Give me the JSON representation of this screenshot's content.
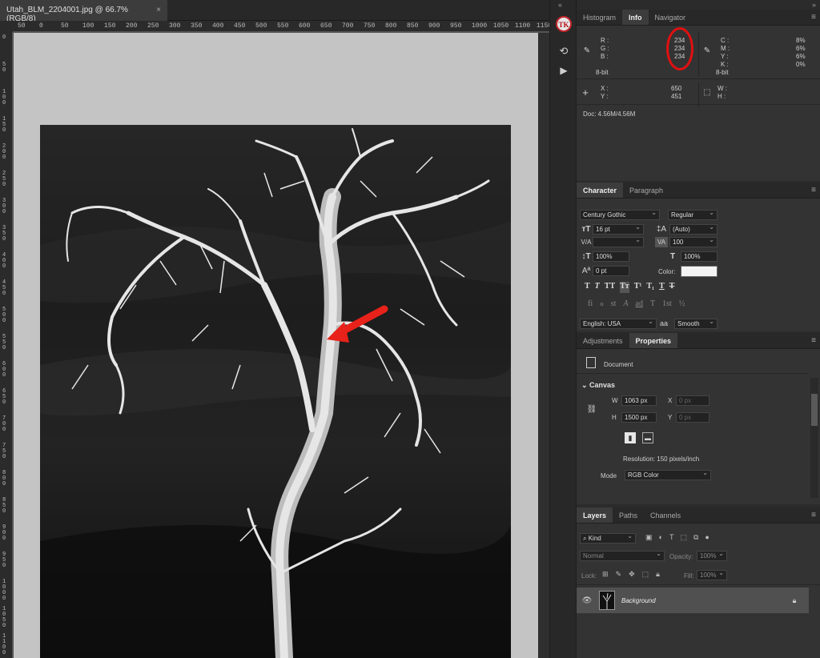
{
  "document": {
    "tab_title": "Utah_BLM_2204001.jpg @ 66.7% (RGB/8)",
    "close_label": "×"
  },
  "ruler": {
    "top_ticks": [
      "50",
      "0",
      "50",
      "100",
      "150",
      "200",
      "250",
      "300",
      "350",
      "400",
      "450",
      "500",
      "550",
      "600",
      "650",
      "700",
      "750",
      "800",
      "850",
      "900",
      "950",
      "1000",
      "1050",
      "1100",
      "1150"
    ],
    "left_ticks": [
      "0",
      "50",
      "100",
      "150",
      "200",
      "250",
      "300",
      "350",
      "400",
      "450",
      "500",
      "550",
      "600",
      "650",
      "700",
      "750",
      "800",
      "850",
      "900",
      "950",
      "1000",
      "1050",
      "1100"
    ]
  },
  "toolstrip": {
    "icons": [
      "tk-logo-icon",
      "history-icon",
      "actions-play-icon"
    ],
    "collapse": "«"
  },
  "panels_collapse": "»",
  "info_panel": {
    "tabs": [
      "Histogram",
      "Info",
      "Navigator"
    ],
    "active_tab": "Info",
    "rgb": {
      "r_label": "R :",
      "g_label": "G :",
      "b_label": "B :",
      "r": "234",
      "g": "234",
      "b": "234",
      "bit": "8-bit"
    },
    "cmyk": {
      "c_label": "C :",
      "m_label": "M :",
      "y_label": "Y :",
      "k_label": "K :",
      "c": "8%",
      "m": "6%",
      "y": "6%",
      "k": "0%",
      "bit": "8-bit"
    },
    "xy": {
      "x_label": "X :",
      "y_label": "Y :",
      "x": "650",
      "y": "451"
    },
    "wh": {
      "w_label": "W :",
      "h_label": "H :"
    },
    "doc_size": "Doc: 4.56M/4.56M",
    "highlight_color": "#e01010"
  },
  "character_panel": {
    "tabs": [
      "Character",
      "Paragraph"
    ],
    "active_tab": "Character",
    "font_family": "Century Gothic",
    "font_style": "Regular",
    "font_size": "16 pt",
    "leading": "(Auto)",
    "kerning": "",
    "tracking": "100",
    "vscale": "100%",
    "hscale": "100%",
    "baseline": "0 pt",
    "color_label": "Color:",
    "text_color": "#f4f4f4",
    "style_buttons": [
      "T",
      "T",
      "TT",
      "Tт",
      "T¹",
      "T₁",
      "T",
      "T"
    ],
    "ot_buttons": [
      "fi",
      "ℴ",
      "st",
      "A",
      "ad",
      "T",
      "1st",
      "½"
    ],
    "language": "English: USA",
    "aa_label": "aa",
    "antialias": "Smooth"
  },
  "properties_panel": {
    "tabs": [
      "Adjustments",
      "Properties"
    ],
    "active_tab": "Properties",
    "doc_label": "Document",
    "section": "Canvas",
    "w_label": "W",
    "h_label": "H",
    "x_label": "X",
    "y_label": "Y",
    "width": "1063 px",
    "height": "1500 px",
    "x_placeholder": "0 px",
    "y_placeholder": "0 px",
    "resolution": "Resolution: 150 pixels/inch",
    "mode_label": "Mode",
    "mode": "RGB Color"
  },
  "layers_panel": {
    "tabs": [
      "Layers",
      "Paths",
      "Channels"
    ],
    "active_tab": "Layers",
    "kind": "Kind",
    "blend": "Normal",
    "opacity_label": "Opacity:",
    "opacity": "100%",
    "lock_label": "Lock:",
    "fill_label": "Fill:",
    "fill": "100%",
    "layers": [
      {
        "name": "Background",
        "visible": true,
        "locked": true
      }
    ]
  }
}
